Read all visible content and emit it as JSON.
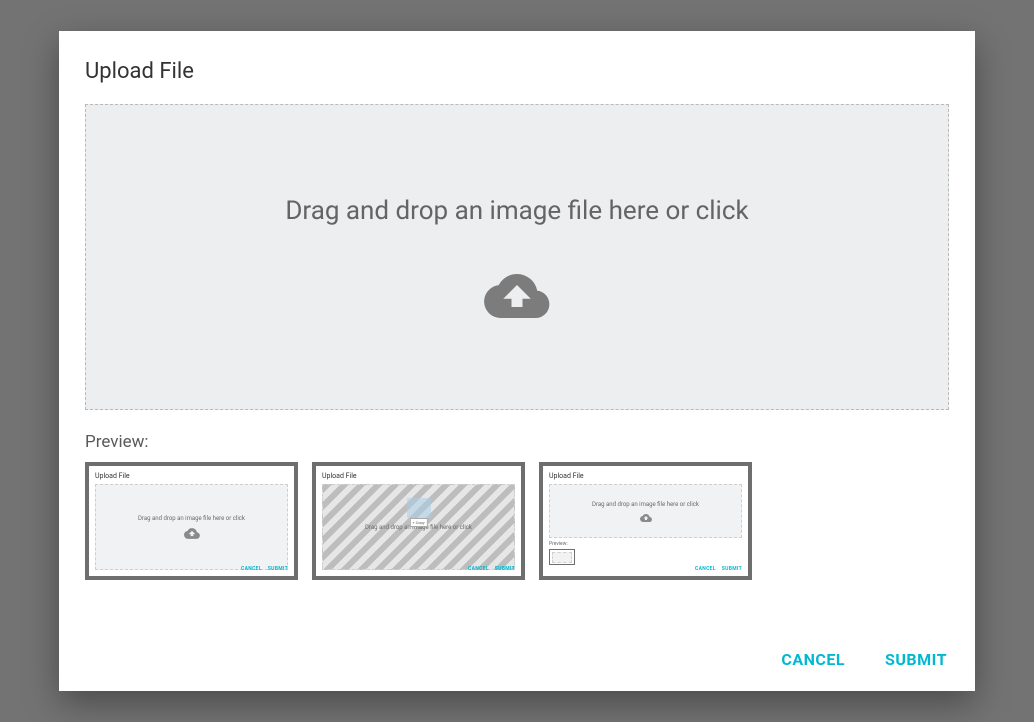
{
  "dialog": {
    "title": "Upload File",
    "dropzone_text": "Drag and drop an image file here or click",
    "preview_label": "Preview:",
    "actions": {
      "cancel": "CANCEL",
      "submit": "SUBMIT"
    }
  },
  "thumbnails": [
    {
      "title": "Upload File",
      "dropzone_text": "Drag and drop an image file here or click",
      "cancel": "CANCEL",
      "submit": "SUBMIT",
      "variant": "normal"
    },
    {
      "title": "Upload File",
      "dropzone_text": "Drag and drop an image file here or click",
      "cancel": "CANCEL",
      "submit": "SUBMIT",
      "copy_label": "+ Copy",
      "variant": "dragover"
    },
    {
      "title": "Upload File",
      "dropzone_text": "Drag and drop an image file here or click",
      "preview_label": "Preview:",
      "cancel": "CANCEL",
      "submit": "SUBMIT",
      "variant": "with-preview"
    }
  ],
  "colors": {
    "accent": "#00b9d1",
    "dropzone_bg": "#eceeef",
    "text_muted": "#646464"
  }
}
